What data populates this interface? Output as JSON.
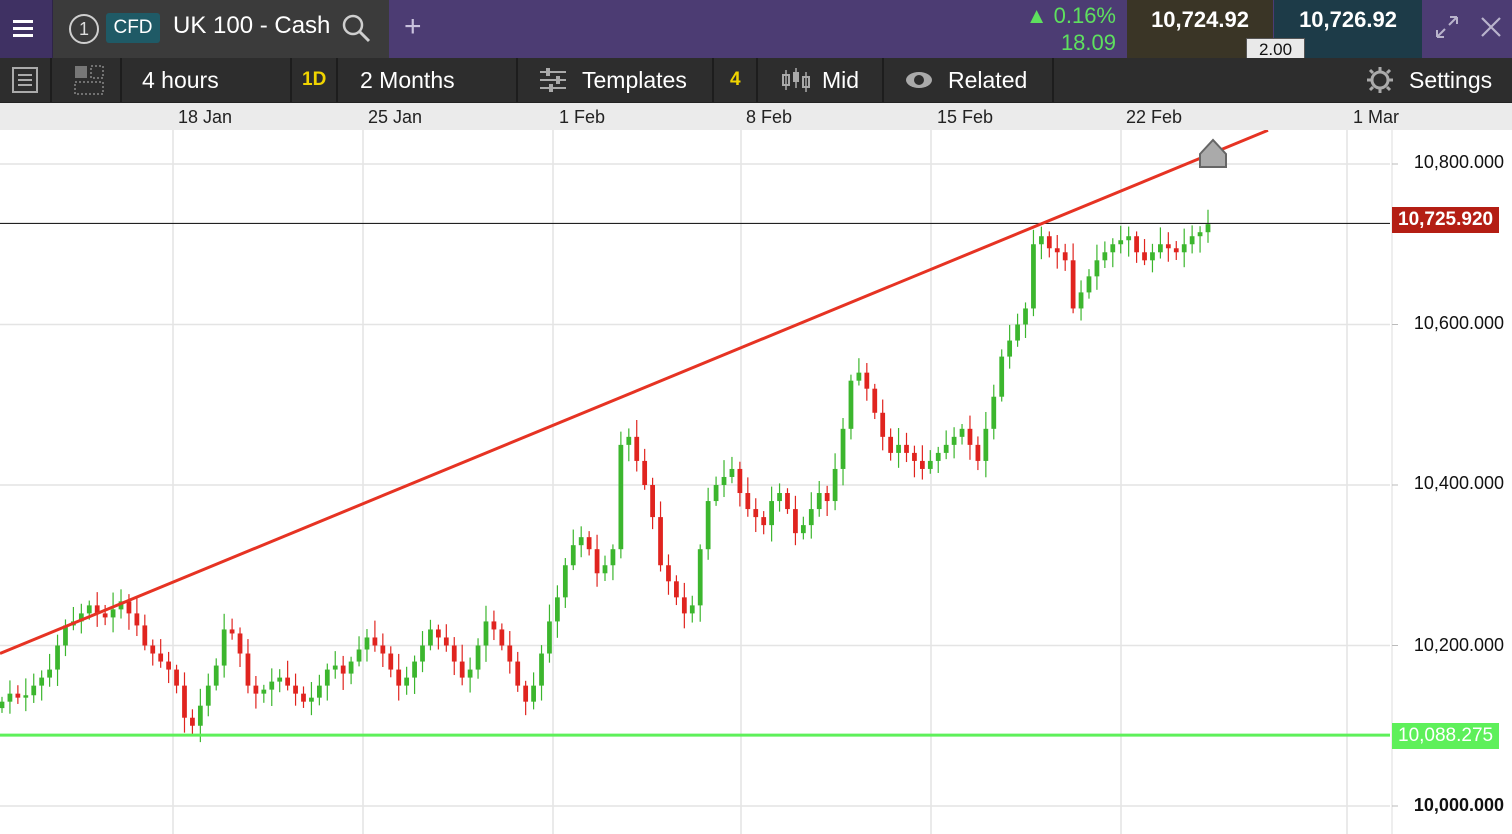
{
  "header": {
    "instrument_number": "1",
    "instrument_type": "CFD",
    "instrument_name": "UK 100 - Cash",
    "add_label": "+",
    "change_pct": "▲ 0.16%",
    "change_abs": "18.09",
    "bid": "10,724.92",
    "ask": "10,726.92",
    "spread": "2.00"
  },
  "toolbar": {
    "interval": "4 hours",
    "period_badge": "1D",
    "range": "2 Months",
    "templates": "Templates",
    "templates_count": "4",
    "price_type": "Mid",
    "related": "Related",
    "settings": "Settings"
  },
  "chart_data": {
    "type": "candlestick",
    "instrument": "UK 100 - Cash",
    "x_ticks": [
      "18 Jan",
      "25 Jan",
      "1 Feb",
      "8 Feb",
      "15 Feb",
      "22 Feb",
      "1 Mar"
    ],
    "y_ticks": [
      "10,800.000",
      "10,600.000",
      "10,400.000",
      "10,200.000",
      "10,000.000"
    ],
    "ylim": [
      9970,
      10840
    ],
    "current_price_label": "10,725.920",
    "current_price": 10725.92,
    "support_label": "10,088.275",
    "support_price": 10088.275,
    "trendline": [
      10190,
      10842
    ],
    "colors": {
      "up": "#3cb62e",
      "down": "#e0241f",
      "trend": "#e63323",
      "support": "#5ef05a",
      "current_tag": "#b41e14"
    },
    "closes": [
      10130,
      10140,
      10135,
      10138,
      10150,
      10160,
      10170,
      10200,
      10225,
      10230,
      10240,
      10250,
      10240,
      10235,
      10245,
      10255,
      10240,
      10225,
      10200,
      10190,
      10180,
      10170,
      10150,
      10110,
      10100,
      10125,
      10150,
      10175,
      10220,
      10215,
      10190,
      10150,
      10140,
      10145,
      10155,
      10160,
      10150,
      10140,
      10130,
      10135,
      10150,
      10170,
      10175,
      10165,
      10180,
      10195,
      10210,
      10200,
      10190,
      10170,
      10150,
      10160,
      10180,
      10200,
      10220,
      10210,
      10200,
      10180,
      10160,
      10170,
      10200,
      10230,
      10220,
      10200,
      10180,
      10150,
      10130,
      10150,
      10190,
      10230,
      10260,
      10300,
      10325,
      10335,
      10320,
      10290,
      10300,
      10320,
      10450,
      10460,
      10430,
      10400,
      10360,
      10300,
      10280,
      10260,
      10240,
      10250,
      10320,
      10380,
      10400,
      10410,
      10420,
      10390,
      10370,
      10360,
      10350,
      10380,
      10390,
      10370,
      10340,
      10350,
      10370,
      10390,
      10380,
      10420,
      10470,
      10530,
      10540,
      10520,
      10490,
      10460,
      10440,
      10450,
      10440,
      10430,
      10420,
      10430,
      10440,
      10450,
      10460,
      10470,
      10450,
      10430,
      10470,
      10510,
      10560,
      10580,
      10600,
      10620,
      10700,
      10710,
      10695,
      10690,
      10680,
      10620,
      10640,
      10660,
      10680,
      10690,
      10700,
      10705,
      10710,
      10690,
      10680,
      10690,
      10700,
      10695,
      10690,
      10700,
      10710,
      10715,
      10725
    ]
  }
}
